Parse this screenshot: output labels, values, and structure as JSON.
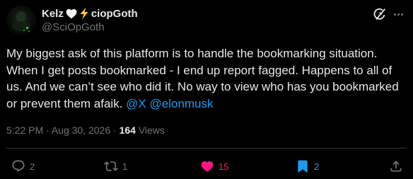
{
  "author": {
    "name_prefix": "Kelz",
    "name_suffix": "ciopGoth",
    "handle": "@SciOpGoth",
    "heart_emoji": "white-heart-icon",
    "bolt_emoji": "lightning-bolt-icon"
  },
  "post": {
    "text_main": "My biggest ask of this platform is to handle the bookmarking situation. When I get posts bookmarked - I end up report fagged. Happens to all of us. And we can’t see who did it. No way to view who has you bookmarked or prevent them afaik.",
    "mention_1": "@X",
    "mention_2": "@elonmusk"
  },
  "meta": {
    "time": "5:22 PM",
    "separator": "·",
    "date": "Aug 30, 2026",
    "views_count": "164",
    "views_label": "Views"
  },
  "actions": {
    "replies": "2",
    "reposts": "1",
    "likes": "15",
    "bookmarks": "2"
  },
  "colors": {
    "background": "#000000",
    "text": "#e7e9ea",
    "muted": "#71767b",
    "link": "#1d9bf0",
    "like": "#f91880",
    "divider": "#2f3336"
  },
  "icons": [
    "grok-icon",
    "more-icon",
    "reply-icon",
    "repost-icon",
    "heart-icon",
    "bookmark-icon",
    "share-icon"
  ]
}
